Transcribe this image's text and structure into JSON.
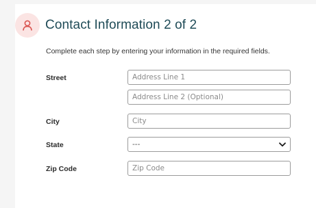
{
  "header": {
    "title": "Contact Information 2 of 2",
    "icon": "person-icon",
    "icon_color": "#d9534f",
    "icon_bg": "#fbe4e3",
    "title_color": "#1f4b57"
  },
  "instructions": "Complete each step by entering your information in the required fields.",
  "form": {
    "street": {
      "label": "Street",
      "line1_placeholder": "Address Line 1",
      "line2_placeholder": "Address Line 2 (Optional)"
    },
    "city": {
      "label": "City",
      "placeholder": "City"
    },
    "state": {
      "label": "State",
      "selected": "---"
    },
    "zip": {
      "label": "Zip Code",
      "placeholder": "Zip Code"
    }
  }
}
